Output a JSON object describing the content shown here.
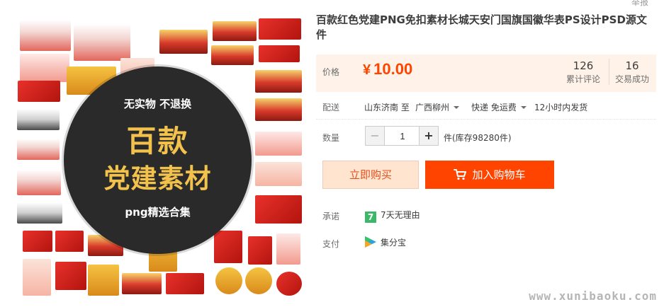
{
  "top": {
    "report_label": "举报"
  },
  "product": {
    "title": "百款红色党建PNG免扣素材长城天安门国旗国徽华表PS设计PSD源文件",
    "image": {
      "badge_top": "无实物 不退换",
      "badge_big_line1": "百款",
      "badge_big_line2": "党建素材",
      "badge_bottom": "png精选合集",
      "watermark": "www.xunibaoku.com"
    }
  },
  "price": {
    "label": "价格",
    "currency": "¥",
    "value": "10.00",
    "reviews_count": "126",
    "reviews_label": "累计评论",
    "deals_count": "16",
    "deals_label": "交易成功"
  },
  "shipping": {
    "label": "配送",
    "from": "山东济南 至",
    "to": "广西柳州",
    "method": "快递 免运费",
    "dispatch": "12小时内发货"
  },
  "quantity": {
    "label": "数量",
    "minus": "−",
    "value": "1",
    "plus": "+",
    "stock_text": "件(库存98280件)"
  },
  "actions": {
    "buy_now_label": "立即购买",
    "add_cart_label": "加入购物车"
  },
  "promise": {
    "label": "承诺",
    "icon_text": "7",
    "text": "7天无理由"
  },
  "payment": {
    "label": "支付",
    "text": "集分宝"
  },
  "colors": {
    "price_red": "#ff4400",
    "price_bg": "#fff2e8",
    "buy_now_bg": "#ffe4d0",
    "add_cart_bg": "#ff4400",
    "badge_gold": "#f3c24c"
  }
}
